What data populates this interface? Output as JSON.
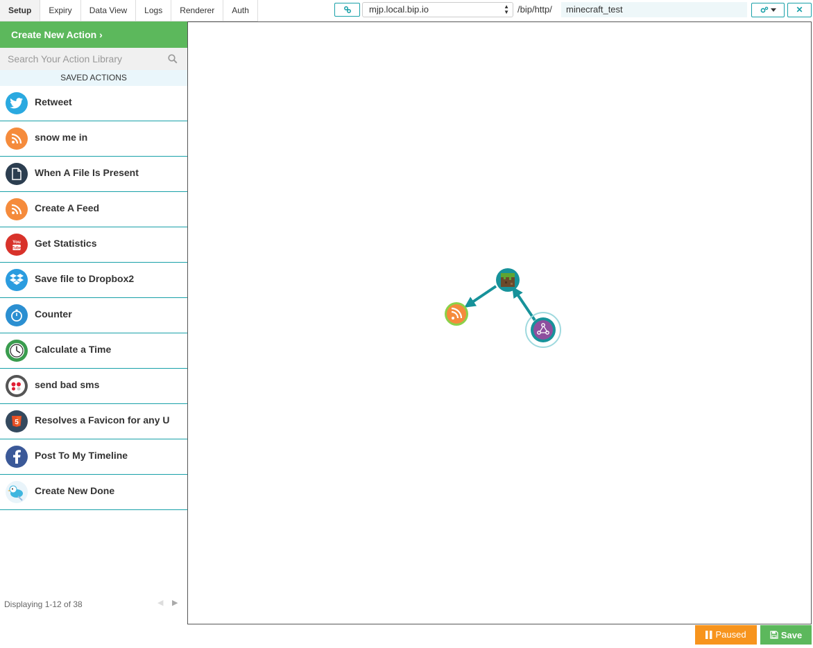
{
  "tabs": [
    "Setup",
    "Expiry",
    "Data View",
    "Logs",
    "Renderer",
    "Auth"
  ],
  "active_tab": "Setup",
  "topbar": {
    "domain": "mjp.local.bip.io",
    "path_prefix": "/bip/http/",
    "path_value": "minecraft_test"
  },
  "sidebar": {
    "create_label": "Create New Action",
    "search_placeholder": "Search Your Action Library",
    "saved_header": "SAVED ACTIONS",
    "actions": [
      {
        "label": "Retweet",
        "icon": "twitter-icon"
      },
      {
        "label": "snow me in",
        "icon": "rss-icon"
      },
      {
        "label": "When A File Is Present",
        "icon": "file-icon"
      },
      {
        "label": "Create A Feed",
        "icon": "rss-icon"
      },
      {
        "label": "Get Statistics",
        "icon": "youtube-icon"
      },
      {
        "label": "Save file to Dropbox2",
        "icon": "dropbox-icon"
      },
      {
        "label": "Counter",
        "icon": "stopwatch-icon"
      },
      {
        "label": "Calculate a Time",
        "icon": "clock-icon"
      },
      {
        "label": "send bad sms",
        "icon": "sms-icon"
      },
      {
        "label": "Resolves a Favicon for any U",
        "icon": "html5-icon"
      },
      {
        "label": "Post To My Timeline",
        "icon": "facebook-icon"
      },
      {
        "label": "Create New Done",
        "icon": "bird-icon"
      }
    ],
    "pager_text": "Displaying 1-12 of 38"
  },
  "footer": {
    "paused_label": "Paused",
    "save_label": "Save"
  },
  "colors": {
    "accent": "#17a0a8",
    "green": "#5cb85c",
    "orange": "#f7941d"
  }
}
